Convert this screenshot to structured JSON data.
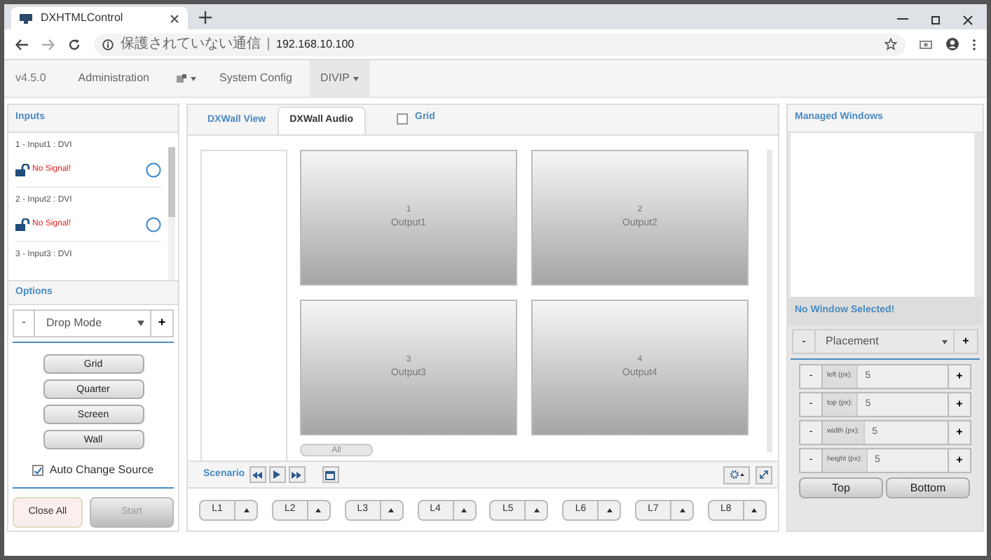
{
  "browser": {
    "tab_title": "DXHTMLControl",
    "security": "保護されていない通信",
    "url": "192.168.10.100"
  },
  "nav": {
    "version": "v4.5.0",
    "items": [
      {
        "kind": "link",
        "label": "Administration",
        "selected": false
      },
      {
        "kind": "icon",
        "selected": false
      },
      {
        "kind": "link",
        "label": "System Config",
        "selected": false
      },
      {
        "kind": "dropdown",
        "label": "DIVIP",
        "selected": true
      }
    ]
  },
  "inputs": {
    "title": "Inputs",
    "items": [
      {
        "label": "1 - Input1 : DVI",
        "status": "No Signal!"
      },
      {
        "label": "2 - Input2 : DVI",
        "status": "No Signal!"
      },
      {
        "label": "3 - Input3 : DVI"
      }
    ]
  },
  "options": {
    "title": "Options",
    "mode": "Drop Mode",
    "minus": "-",
    "plus": "+",
    "buttons": [
      "Grid",
      "Quarter",
      "Screen",
      "Wall"
    ],
    "auto_change": {
      "label": "Auto Change Source",
      "checked": true
    },
    "close_all": "Close All",
    "start": {
      "label": "Start",
      "disabled": true
    }
  },
  "center": {
    "tabs": [
      {
        "label": "DXWall View",
        "selected": false
      },
      {
        "label": "DXWall Audio",
        "selected": true
      }
    ],
    "grid": {
      "label": "Grid",
      "checked": false
    },
    "outputs": [
      {
        "number": "1",
        "name": "Output1"
      },
      {
        "number": "2",
        "name": "Output2"
      },
      {
        "number": "3",
        "name": "Output3"
      },
      {
        "number": "4",
        "name": "Output4"
      }
    ],
    "all_button": "All",
    "scenario": "Scenario",
    "layouts": [
      "L1",
      "L2",
      "L3",
      "L4",
      "L5",
      "L6",
      "L7",
      "L8"
    ]
  },
  "right": {
    "title": "Managed Windows",
    "selection": "No Window Selected!",
    "placement": "Placement",
    "minus": "-",
    "plus": "+",
    "fields": [
      {
        "label": "left (px):",
        "value": "5",
        "minus": "-",
        "plus": "+"
      },
      {
        "label": "top (px):",
        "value": "5",
        "minus": "-",
        "plus": "+"
      },
      {
        "label": "width (px):",
        "value": "5",
        "minus": "-",
        "plus": "+"
      },
      {
        "label": "height (px):",
        "value": "5",
        "minus": "-",
        "plus": "+"
      }
    ],
    "top": "Top",
    "bottom": "Bottom"
  }
}
